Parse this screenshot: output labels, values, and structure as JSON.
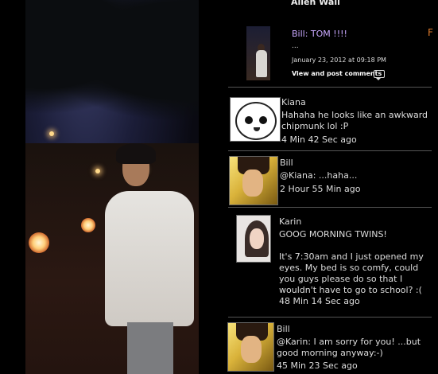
{
  "wall": {
    "title": "Alien Wall",
    "edge_mark": "F"
  },
  "post": {
    "title": "Bill: TOM !!!!",
    "body": "...",
    "date": "January 23, 2012 at 09:18 PM",
    "comments_link": "View and post comments",
    "comments_icon": "comment-bubble-icon"
  },
  "comments": [
    {
      "name": "Kiana",
      "text_lines": [
        "Hahaha he looks like an awkward",
        "chipmunk lol :P"
      ],
      "time": "4 Min 42 Sec ago",
      "avatar": "cartoon-face-avatar"
    },
    {
      "name": "Bill",
      "text_lines": [
        "@Kiana: ...haha..."
      ],
      "time": "2 Hour 55 Min ago",
      "avatar": "bill-avatar"
    },
    {
      "name": "Karin",
      "text_lines": [
        "GOOG MORNING TWINS!",
        "",
        "It's 7:30am and I just opened my",
        "eyes. My bed is so comfy, could",
        "you guys please do so that I",
        "wouldn't have to go to school? :("
      ],
      "time": "48 Min 14 Sec ago",
      "avatar": "karin-avatar"
    },
    {
      "name": "Bill",
      "text_lines": [
        "@Karin: I am sorry for you! ...but",
        "good morning anyway:-)"
      ],
      "time": "45 Min 23 Sec ago",
      "avatar": "bill-avatar"
    }
  ],
  "colors": {
    "background": "#000000",
    "post_title": "#c9a8ff",
    "accent_orange": "#e07a2a",
    "text": "#dddddd"
  }
}
